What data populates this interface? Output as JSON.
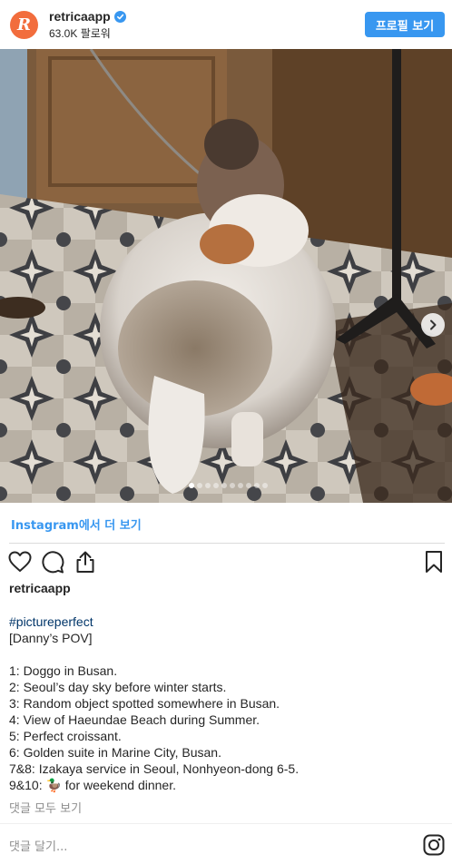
{
  "header": {
    "avatar_letter": "R",
    "username": "retricaapp",
    "followers": "63.0K 팔로워",
    "profile_button": "프로필 보기",
    "brand_color": "#3897f0"
  },
  "post": {
    "photo_description_icon": "dog-photo",
    "carousel": {
      "total": 10,
      "active_index": 0
    },
    "view_more": "Instagram에서 더 보기",
    "username": "retricaapp",
    "caption_lines": [
      "#pictureperfect",
      "[Danny’s POV]",
      "",
      "1: Doggo in Busan.",
      "2: Seoul’s day sky before winter starts.",
      "3: Random object spotted somewhere in Busan.",
      "4: View of Haeundae Beach during Summer.",
      "5: Perfect croissant.",
      "6: Golden suite in Marine City, Busan.",
      "7&8: Izakaya service in Seoul, Nonhyeon-dong 6-5.",
      "9&10: 🦆 for weekend dinner."
    ],
    "view_all_comments": "댓글 모두 보기",
    "comment_placeholder": "댓글 달기..."
  },
  "icons": [
    "verified-icon",
    "chevron-right-icon",
    "heart-icon",
    "comment-icon",
    "share-icon",
    "bookmark-icon",
    "instagram-icon"
  ]
}
